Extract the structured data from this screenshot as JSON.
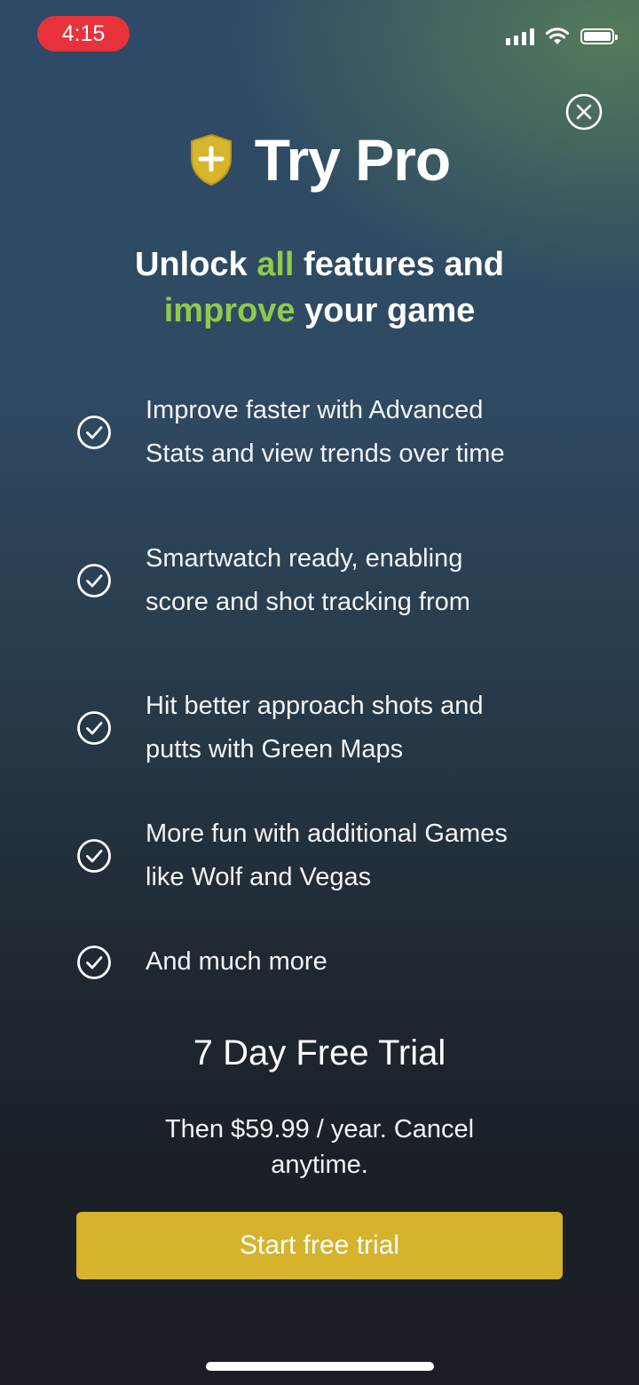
{
  "status_bar": {
    "time": "4:15",
    "icons": [
      "signal-icon",
      "wifi-icon",
      "battery-icon"
    ]
  },
  "close_icon": "close-icon",
  "header": {
    "logo_icon": "shield-plus-icon",
    "title": "Try Pro"
  },
  "subtitle": {
    "part1": "Unlock ",
    "accent1": "all",
    "part2": " features and",
    "accent2": "improve",
    "part3": " your game"
  },
  "features": [
    {
      "line1": "Improve faster with Advanced",
      "line2": "Stats and view trends over time"
    },
    {
      "line1": "Smartwatch ready, enabling",
      "line2": "score and shot tracking from"
    },
    {
      "line1": "Hit better approach shots and",
      "line2": "putts with Green Maps"
    },
    {
      "line1": "More fun with additional Games",
      "line2": "like Wolf and Vegas"
    },
    {
      "line1": "And much more",
      "line2": ""
    }
  ],
  "trial": {
    "title": "7 Day Free Trial",
    "subtitle": "Then $59.99 / year. Cancel anytime."
  },
  "cta": {
    "label": "Start free trial"
  },
  "colors": {
    "accent_green": "#8ecb4c",
    "cta_gold": "#d5b32c",
    "time_pill_red": "#e8323b",
    "shield_gold": "#d7b52d"
  }
}
